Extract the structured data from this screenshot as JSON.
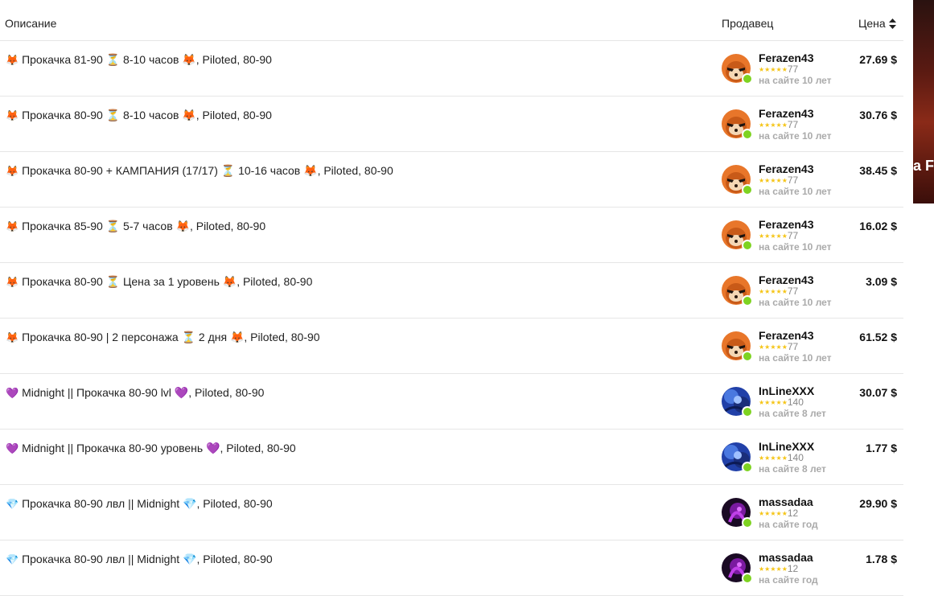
{
  "header": {
    "description_label": "Описание",
    "seller_label": "Продавец",
    "price_label": "Цена"
  },
  "side_banner": {
    "text": "a F"
  },
  "rows": [
    {
      "icon": "🦊",
      "description": "Прокачка 81-90 ⏳ 8-10 часов 🦊, Piloted, 80-90",
      "seller": "Ferazen43",
      "stars": "★★★★★",
      "rating": "77",
      "since": "на сайте 10 лет",
      "price": "27.69 $",
      "avatar": "fox"
    },
    {
      "icon": "🦊",
      "description": "Прокачка 80-90 ⏳ 8-10 часов 🦊, Piloted, 80-90",
      "seller": "Ferazen43",
      "stars": "★★★★★",
      "rating": "77",
      "since": "на сайте 10 лет",
      "price": "30.76 $",
      "avatar": "fox"
    },
    {
      "icon": "🦊",
      "description": "Прокачка 80-90 + КАМПАНИЯ (17/17) ⏳ 10-16 часов 🦊, Piloted, 80-90",
      "seller": "Ferazen43",
      "stars": "★★★★★",
      "rating": "77",
      "since": "на сайте 10 лет",
      "price": "38.45 $",
      "avatar": "fox"
    },
    {
      "icon": "🦊",
      "description": "Прокачка 85-90 ⏳ 5-7 часов 🦊, Piloted, 80-90",
      "seller": "Ferazen43",
      "stars": "★★★★★",
      "rating": "77",
      "since": "на сайте 10 лет",
      "price": "16.02 $",
      "avatar": "fox"
    },
    {
      "icon": "🦊",
      "description": "Прокачка 80-90 ⏳ Цена за 1 уровень 🦊, Piloted, 80-90",
      "seller": "Ferazen43",
      "stars": "★★★★★",
      "rating": "77",
      "since": "на сайте 10 лет",
      "price": "3.09 $",
      "avatar": "fox"
    },
    {
      "icon": "🦊",
      "description": "Прокачка 80-90 | 2 персонажа ⏳ 2 дня 🦊, Piloted, 80-90",
      "seller": "Ferazen43",
      "stars": "★★★★★",
      "rating": "77",
      "since": "на сайте 10 лет",
      "price": "61.52 $",
      "avatar": "fox"
    },
    {
      "icon": "💜",
      "description": "Midnight || Прокачка 80-90 lvl 💜, Piloted, 80-90",
      "seller": "InLineXXX",
      "stars": "★★★★★",
      "rating": "140",
      "since": "на сайте 8 лет",
      "price": "30.07 $",
      "avatar": "blue"
    },
    {
      "icon": "💜",
      "description": "Midnight || Прокачка 80-90 уровень 💜, Piloted, 80-90",
      "seller": "InLineXXX",
      "stars": "★★★★★",
      "rating": "140",
      "since": "на сайте 8 лет",
      "price": "1.77 $",
      "avatar": "blue"
    },
    {
      "icon": "💎",
      "description": "Прокачка 80-90 лвл || Midnight 💎, Piloted, 80-90",
      "seller": "massadaa",
      "stars": "★★★★★",
      "rating": "12",
      "since": "на сайте год",
      "price": "29.90 $",
      "avatar": "purple"
    },
    {
      "icon": "💎",
      "description": "Прокачка 80-90 лвл || Midnight 💎, Piloted, 80-90",
      "seller": "massadaa",
      "stars": "★★★★★",
      "rating": "12",
      "since": "на сайте год",
      "price": "1.78 $",
      "avatar": "purple"
    }
  ]
}
